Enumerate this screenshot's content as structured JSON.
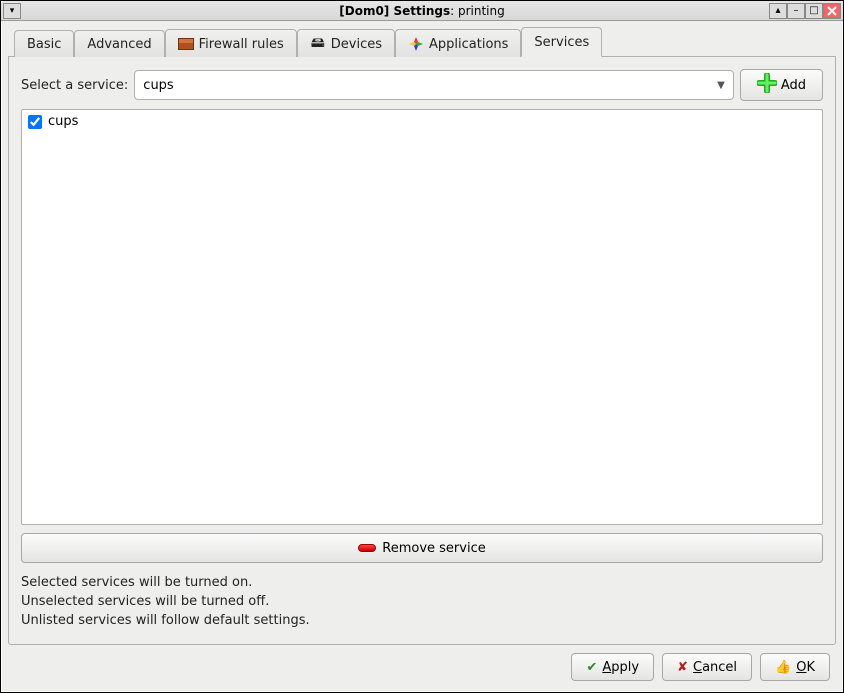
{
  "window": {
    "title_prefix": "[Dom0] ",
    "title_main": "Settings",
    "title_suffix": ": printing"
  },
  "tabs": {
    "basic": "Basic",
    "advanced": "Advanced",
    "firewall": "Firewall rules",
    "devices": "Devices",
    "applications": "Applications",
    "services": "Services"
  },
  "services": {
    "select_label": "Select a service:",
    "combo_value": "cups",
    "add_button": "Add",
    "list": [
      {
        "name": "cups",
        "checked": true
      }
    ],
    "remove_button": "Remove service",
    "hint1": "Selected services will be turned on.",
    "hint2": "Unselected services will be turned off.",
    "hint3": "Unlisted services will follow default settings."
  },
  "footer": {
    "apply": "Apply",
    "cancel": "Cancel",
    "ok": "OK"
  }
}
